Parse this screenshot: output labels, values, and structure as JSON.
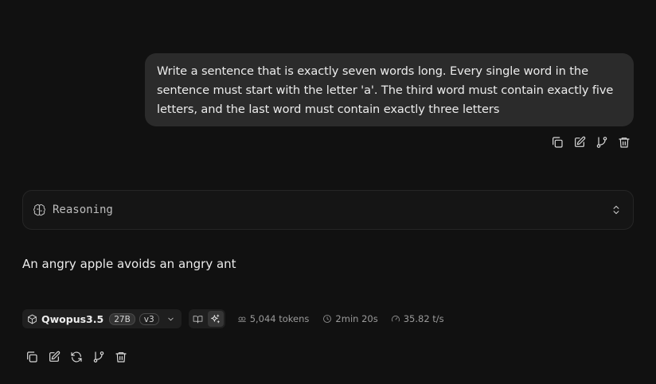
{
  "user_message": {
    "text": "Write a sentence that is exactly seven words long. Every single word in the sentence must start with the letter 'a'. The third word must contain exactly five letters, and the last word must contain exactly three letters"
  },
  "user_actions": [
    "copy-icon",
    "edit-icon",
    "branch-icon",
    "trash-icon"
  ],
  "reasoning": {
    "label": "Reasoning",
    "icon": "brain-icon",
    "expanded": false
  },
  "assistant_message": {
    "text": "An angry apple avoids an angry ant"
  },
  "meta": {
    "model_name": "Qwopus3.5",
    "model_size": "27B",
    "model_version": "v3",
    "tokens": "5,044 tokens",
    "duration": "2min 20s",
    "speed": "35.82 t/s"
  },
  "assistant_actions": [
    "copy-icon",
    "edit-icon",
    "regenerate-icon",
    "branch-icon",
    "trash-icon"
  ],
  "colors": {
    "background": "#111111",
    "bubble": "#2b2b2b",
    "text": "#ececec",
    "muted": "#9a9a9a"
  }
}
